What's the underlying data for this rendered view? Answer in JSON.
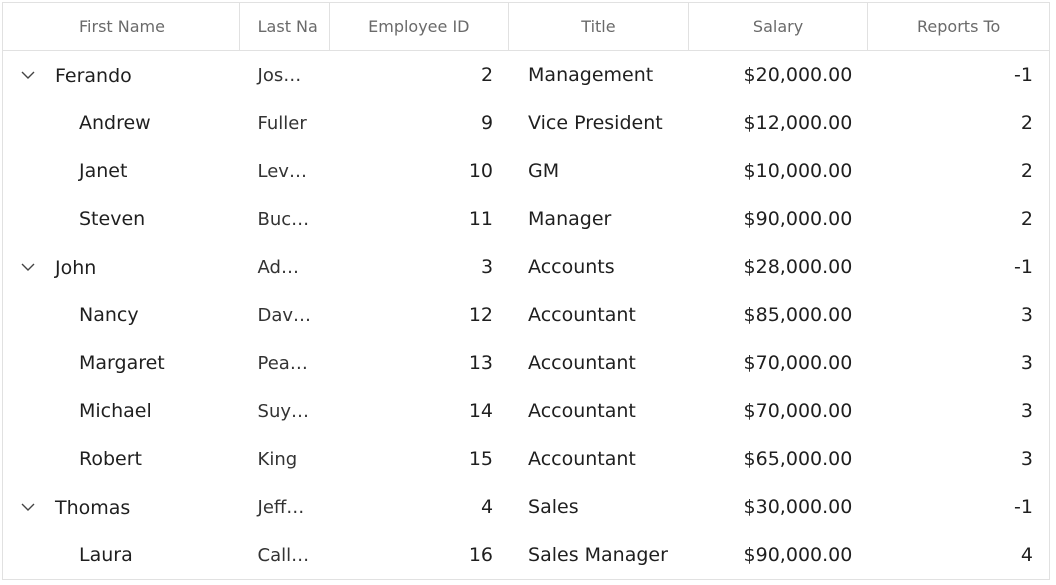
{
  "grid": {
    "columns": [
      {
        "key": "first_name",
        "label": "First Name"
      },
      {
        "key": "last_name",
        "label": "Last Na"
      },
      {
        "key": "employee_id",
        "label": "Employee ID"
      },
      {
        "key": "title",
        "label": "Title"
      },
      {
        "key": "salary",
        "label": "Salary"
      },
      {
        "key": "reports_to",
        "label": "Reports To"
      }
    ],
    "rows": [
      {
        "first_name": "Ferando",
        "last_name": "Jos…",
        "employee_id": "2",
        "title": "Management",
        "salary": "$20,000.00",
        "reports_to": "-1",
        "level": 0,
        "expandable": true,
        "expanded": true
      },
      {
        "first_name": "Andrew",
        "last_name": "Fuller",
        "employee_id": "9",
        "title": "Vice President",
        "salary": "$12,000.00",
        "reports_to": "2",
        "level": 1,
        "expandable": false
      },
      {
        "first_name": "Janet",
        "last_name": "Lev…",
        "employee_id": "10",
        "title": "GM",
        "salary": "$10,000.00",
        "reports_to": "2",
        "level": 1,
        "expandable": false
      },
      {
        "first_name": "Steven",
        "last_name": "Buc…",
        "employee_id": "11",
        "title": "Manager",
        "salary": "$90,000.00",
        "reports_to": "2",
        "level": 1,
        "expandable": false
      },
      {
        "first_name": "John",
        "last_name": "Ad…",
        "employee_id": "3",
        "title": "Accounts",
        "salary": "$28,000.00",
        "reports_to": "-1",
        "level": 0,
        "expandable": true,
        "expanded": true
      },
      {
        "first_name": "Nancy",
        "last_name": "Dav…",
        "employee_id": "12",
        "title": "Accountant",
        "salary": "$85,000.00",
        "reports_to": "3",
        "level": 1,
        "expandable": false
      },
      {
        "first_name": "Margaret",
        "last_name": "Pea…",
        "employee_id": "13",
        "title": "Accountant",
        "salary": "$70,000.00",
        "reports_to": "3",
        "level": 1,
        "expandable": false
      },
      {
        "first_name": "Michael",
        "last_name": "Suy…",
        "employee_id": "14",
        "title": "Accountant",
        "salary": "$70,000.00",
        "reports_to": "3",
        "level": 1,
        "expandable": false
      },
      {
        "first_name": "Robert",
        "last_name": "King",
        "employee_id": "15",
        "title": "Accountant",
        "salary": "$65,000.00",
        "reports_to": "3",
        "level": 1,
        "expandable": false
      },
      {
        "first_name": "Thomas",
        "last_name": "Jeff…",
        "employee_id": "4",
        "title": "Sales",
        "salary": "$30,000.00",
        "reports_to": "-1",
        "level": 0,
        "expandable": true,
        "expanded": true
      },
      {
        "first_name": "Laura",
        "last_name": "Call…",
        "employee_id": "16",
        "title": "Sales Manager",
        "salary": "$90,000.00",
        "reports_to": "4",
        "level": 1,
        "expandable": false
      }
    ]
  },
  "icons": {
    "expand": "chevron-down-icon"
  },
  "colors": {
    "header_text": "#6a6a6a",
    "border": "#e1e1e1",
    "cell_text": "#1f1f1f"
  }
}
